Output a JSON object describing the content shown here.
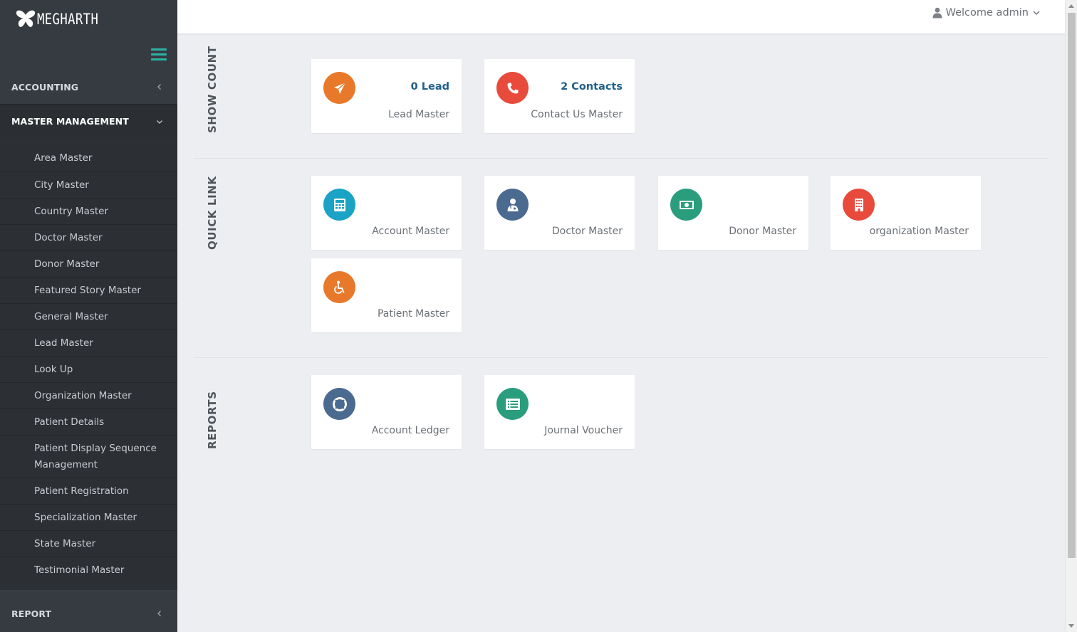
{
  "brand": {
    "name": "MEGHARTH"
  },
  "topbar": {
    "welcome": "Welcome admin"
  },
  "sidebar": {
    "sections": {
      "accounting": "ACCOUNTING",
      "master": "MASTER MANAGEMENT",
      "report": "REPORT"
    },
    "items": [
      "Area Master",
      "City Master",
      "Country Master",
      "Doctor Master",
      "Donor Master",
      "Featured Story Master",
      "General Master",
      "Lead Master",
      "Look Up",
      "Organization Master",
      "Patient Details",
      "Patient Display Sequence Management",
      "Patient Registration",
      "Specialization Master",
      "State Master",
      "Testimonial Master"
    ]
  },
  "sections": {
    "show_count": {
      "label": "SHOW COUNT",
      "cards": [
        {
          "count": "0 Lead",
          "name": "Lead Master",
          "color": "#e8792b",
          "icon": "paper-plane-icon"
        },
        {
          "count": "2 Contacts",
          "name": "Contact Us Master",
          "color": "#e84a3c",
          "icon": "phone-icon"
        }
      ]
    },
    "quick_link": {
      "label": "QUICK LINK",
      "cards": [
        {
          "name": "Account Master",
          "color": "#1aa3c4",
          "icon": "calculator-icon"
        },
        {
          "name": "Doctor Master",
          "color": "#4b6a8f",
          "icon": "doctor-icon"
        },
        {
          "name": "Donor Master",
          "color": "#2a9d7c",
          "icon": "money-icon"
        },
        {
          "name": "organization Master",
          "color": "#e84a3c",
          "icon": "building-icon"
        },
        {
          "name": "Patient Master",
          "color": "#e8792b",
          "icon": "wheelchair-icon"
        }
      ]
    },
    "reports": {
      "label": "REPORTS",
      "cards": [
        {
          "name": "Account Ledger",
          "color": "#4b6a8f",
          "icon": "life-ring-icon"
        },
        {
          "name": "Journal Voucher",
          "color": "#2a9d7c",
          "icon": "list-alt-icon"
        }
      ]
    }
  }
}
